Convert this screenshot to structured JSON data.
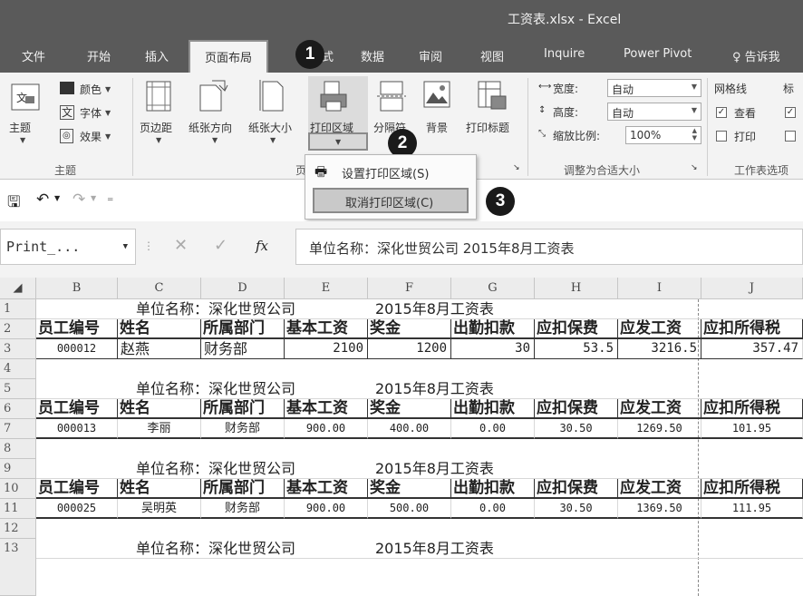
{
  "window": {
    "title": "工资表.xlsx - Excel"
  },
  "tabs": [
    {
      "label": "文件"
    },
    {
      "label": "开始"
    },
    {
      "label": "插入"
    },
    {
      "label": "页面布局"
    },
    {
      "label": "公式"
    },
    {
      "label": "数据"
    },
    {
      "label": "审阅"
    },
    {
      "label": "视图"
    },
    {
      "label": "Inquire"
    },
    {
      "label": "Power Pivot"
    },
    {
      "label": "告诉我"
    }
  ],
  "ribbon": {
    "themes": {
      "theme": "主题",
      "colors": "颜色",
      "fonts": "字体",
      "effects": "效果",
      "group": "主题"
    },
    "page_setup": {
      "margins": "页边距",
      "orientation": "纸张方向",
      "size": "纸张大小",
      "print_area": "打印区域",
      "breaks": "分隔符",
      "background": "背景",
      "print_titles": "打印标题",
      "group": "页"
    },
    "scale": {
      "width_label": "宽度:",
      "width_value": "自动",
      "height_label": "高度:",
      "height_value": "自动",
      "scale_label": "缩放比例:",
      "scale_value": "100%",
      "group": "调整为合适大小"
    },
    "sheet_options": {
      "gridlines": "网格线",
      "headings": "标",
      "view": "查看",
      "print": "打印",
      "group": "工作表选项"
    }
  },
  "menu": {
    "set_print_area": "设置打印区域(S)",
    "clear_print_area": "取消打印区域(C)"
  },
  "steps": [
    "1",
    "2",
    "3"
  ],
  "namebox": {
    "value": "Print_..."
  },
  "formula": {
    "fx": "fx",
    "content": "单位名称：深化世贸公司     2015年8月工资表"
  },
  "columns": [
    "B",
    "C",
    "D",
    "E",
    "F",
    "G",
    "H",
    "I",
    "J"
  ],
  "rows": [
    "1",
    "2",
    "3",
    "4",
    "5",
    "6",
    "7",
    "8",
    "9",
    "10",
    "11",
    "12",
    "13"
  ],
  "sheet": {
    "company": "单位名称：深化世贸公司",
    "period": "2015年8月工资表",
    "headers": [
      "员工编号",
      "姓名",
      "所属部门",
      "基本工资",
      "奖金",
      "出勤扣款",
      "应扣保费",
      "应发工资",
      "应扣所得税"
    ],
    "records": [
      [
        "000012",
        "赵燕",
        "财务部",
        "2100",
        "1200",
        "30",
        "53.5",
        "3216.5",
        "357.47"
      ],
      [
        "000013",
        "李丽",
        "财务部",
        "900.00",
        "400.00",
        "0.00",
        "30.50",
        "1269.50",
        "101.95"
      ],
      [
        "000025",
        "吴明英",
        "财务部",
        "900.00",
        "500.00",
        "0.00",
        "30.50",
        "1369.50",
        "111.95"
      ]
    ]
  }
}
